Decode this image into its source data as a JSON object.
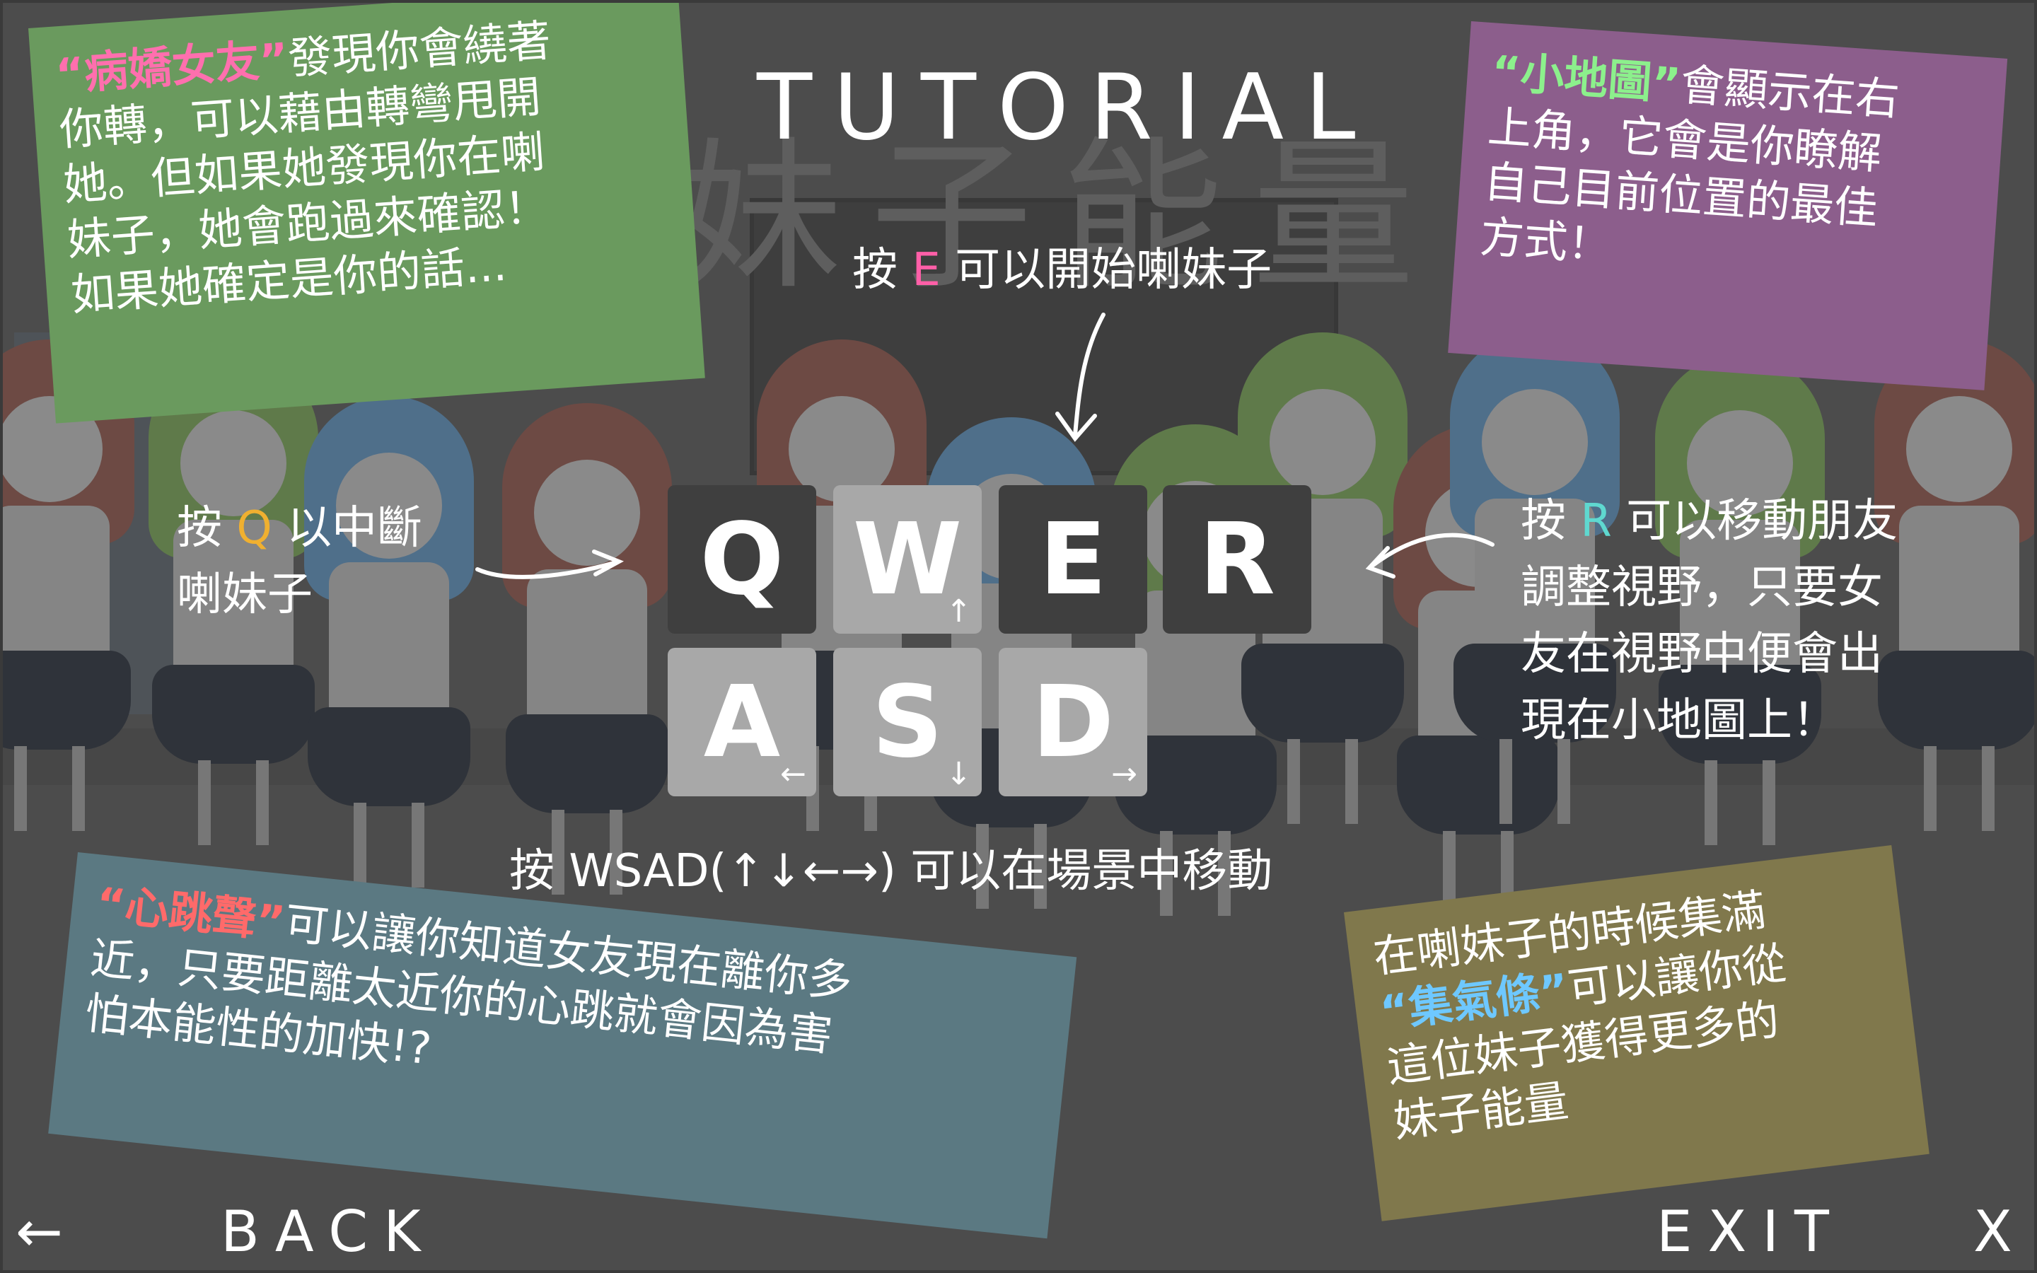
{
  "title": "TUTORIAL",
  "background_title": "妹子能量",
  "keys": {
    "row1": [
      {
        "letter": "Q",
        "arrow": "",
        "style": "dark"
      },
      {
        "letter": "W",
        "arrow": "↑",
        "style": "light"
      },
      {
        "letter": "E",
        "arrow": "",
        "style": "dark"
      },
      {
        "letter": "R",
        "arrow": "",
        "style": "dark"
      }
    ],
    "row2": [
      {
        "letter": "A",
        "arrow": "←",
        "style": "light"
      },
      {
        "letter": "S",
        "arrow": "↓",
        "style": "light"
      },
      {
        "letter": "D",
        "arrow": "→",
        "style": "light"
      }
    ]
  },
  "labels": {
    "e_prefix": "按 ",
    "e_key": "E",
    "e_suffix": " 可以開始喇妹子",
    "q_prefix": "按 ",
    "q_key": "Q",
    "q_suffix": " 以中斷",
    "q_line2": "喇妹子",
    "r_prefix": "按 ",
    "r_key": "R",
    "r_suffix": " 可以移動朋友",
    "r_line2": "調整視野，只要女",
    "r_line3": "友在視野中便會出",
    "r_line4": "現在小地圖上！",
    "wsad": "按 WSAD(↑↓←→) 可以在場景中移動"
  },
  "notes": {
    "yandere": {
      "highlight": "“病嬌女友”",
      "line1": "發現你會繞著",
      "line2": "你轉，可以藉由轉彎甩開",
      "line3": "她。但如果她發現你在喇",
      "line4": "妹子，她會跑過來確認！",
      "line5": "如果她確定是你的話...",
      "bg": "#6a9a5e",
      "hl_color": "#ff6fae"
    },
    "minimap": {
      "highlight": "“小地圖”",
      "line1": "會顯示在右",
      "line2": "上角，它會是你瞭解",
      "line3": "自己目前位置的最佳",
      "line4": "方式！",
      "bg": "#8c5e8c",
      "hl_color": "#8cf08c"
    },
    "heartbeat": {
      "highlight": "“心跳聲”",
      "line1": "可以讓你知道女友現在離你多",
      "line2": "近，只要距離太近你的心跳就會因為害",
      "line3": "怕本能性的加快!?",
      "bg": "#5b7982",
      "hl_color": "#ff6a6a"
    },
    "gauge": {
      "line1": "在喇妹子的時候集滿",
      "highlight": "“集氣條”",
      "line2": "可以讓你從",
      "line3": "這位妹子獲得更多的",
      "line4": "妹子能量",
      "bg": "#80784c",
      "hl_color": "#6ec8ff"
    }
  },
  "colors": {
    "e_key": "#ff5fa8",
    "q_key": "#f0b030",
    "r_key": "#5fd8d0"
  },
  "nav": {
    "back_arrow": "←",
    "back_label": "BACK",
    "exit_label": "EXIT",
    "close_label": "X"
  }
}
